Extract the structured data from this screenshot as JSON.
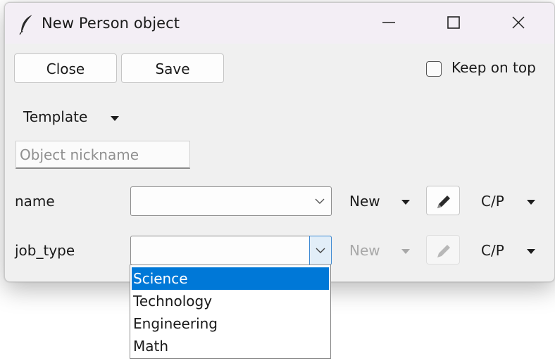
{
  "window": {
    "title": "New Person object",
    "icon": "feather-icon"
  },
  "toolbar": {
    "close_label": "Close",
    "save_label": "Save",
    "keep_on_top_label": "Keep on top",
    "keep_on_top_checked": false
  },
  "template_menu": {
    "label": "Template"
  },
  "nickname": {
    "placeholder": "Object nickname",
    "value": ""
  },
  "fields": [
    {
      "label": "name",
      "value": "",
      "new_label": "New",
      "cp_label": "C/P",
      "enabled": true
    },
    {
      "label": "job_type",
      "value": "",
      "new_label": "New",
      "cp_label": "C/P",
      "enabled": false
    }
  ],
  "job_type_dropdown": {
    "options": [
      "Science",
      "Technology",
      "Engineering",
      "Math"
    ],
    "highlighted_index": 0
  },
  "colors": {
    "selection": "#0078d7",
    "titlebar": "#f3eef5",
    "window_bg": "#f0f0f0"
  }
}
